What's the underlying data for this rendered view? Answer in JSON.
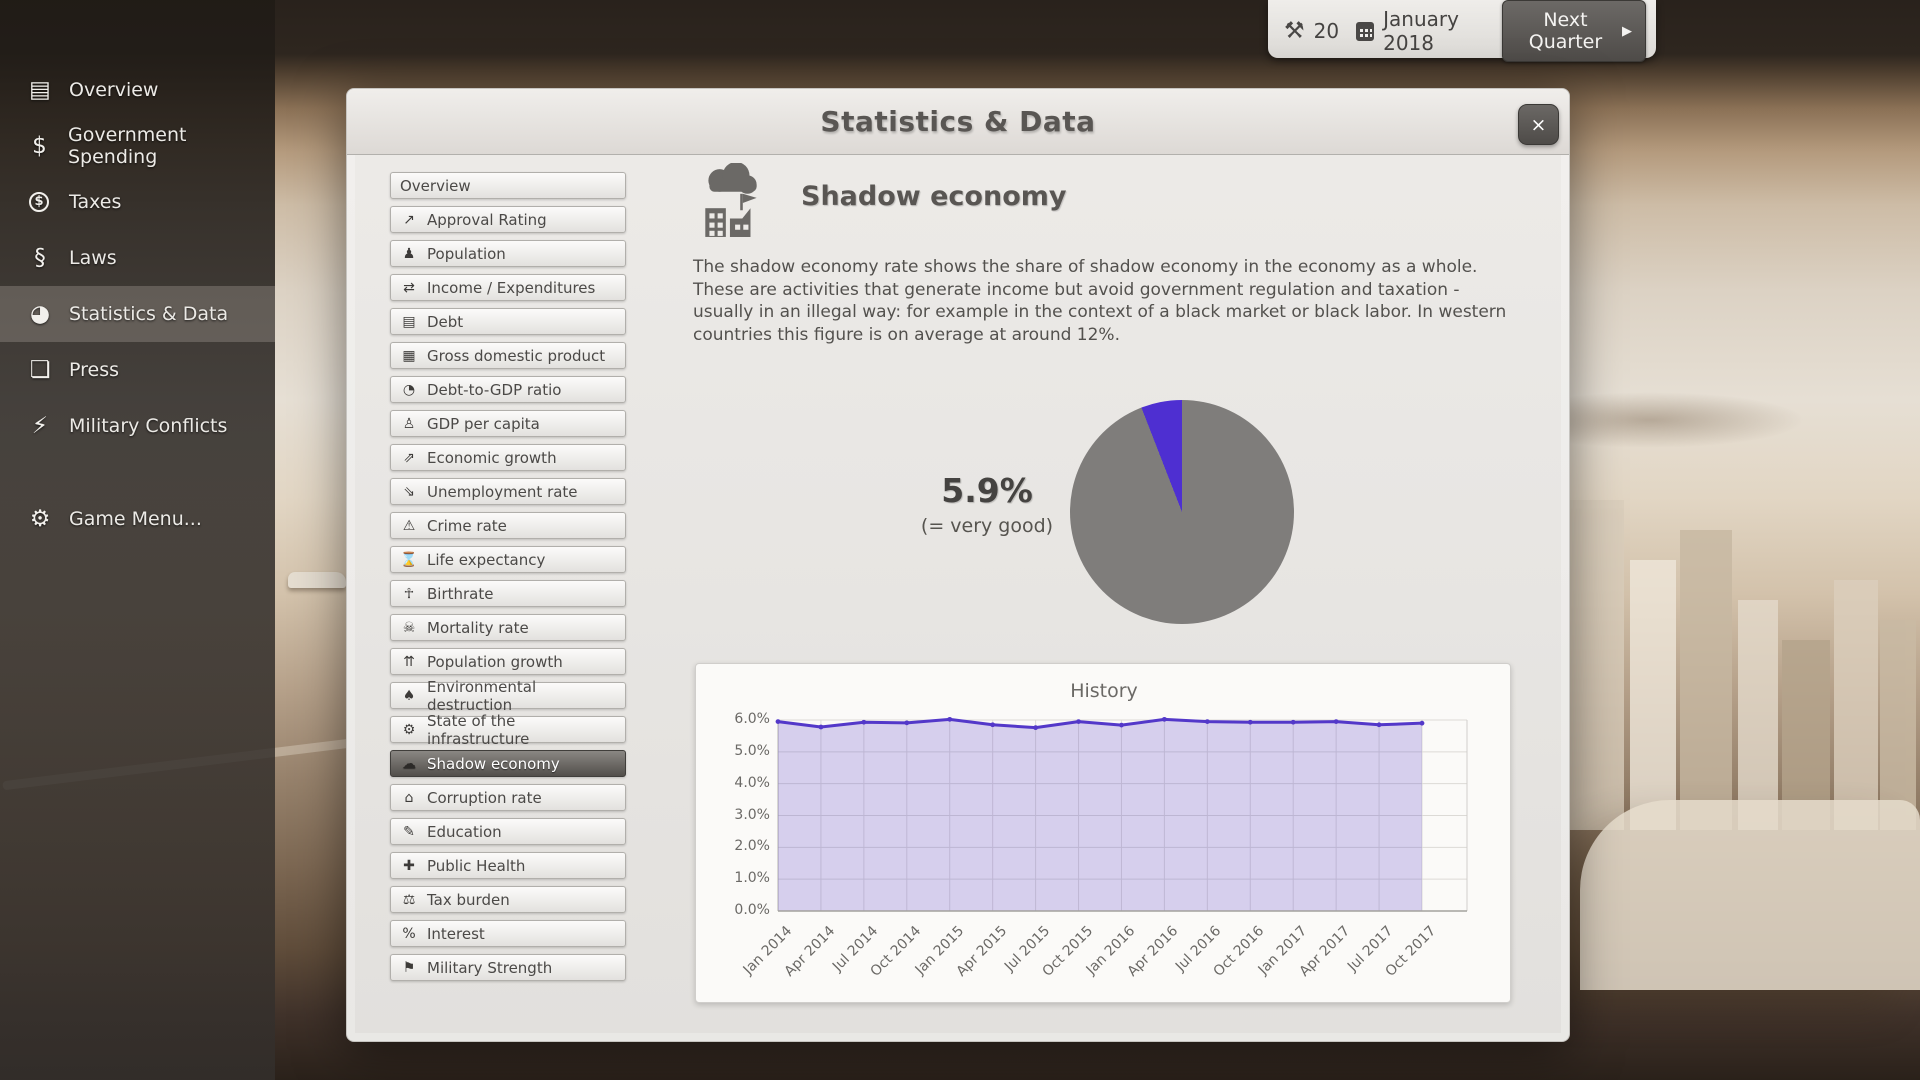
{
  "colors": {
    "accent_purple": "#4e2fd1",
    "pie_remainder_gray": "#7f7d7b",
    "chart_line": "#5338c9",
    "chart_fill": "rgba(83,56,201,0.22)"
  },
  "top_bar": {
    "tools_icon": "hammer-wrench-icon",
    "tools_glyph": "⚒",
    "tools_count": "20",
    "date": "January 2018",
    "next_quarter_label": "Next Quarter",
    "next_quarter_arrow": "▶"
  },
  "sidebar": {
    "items": [
      {
        "label": "Overview",
        "icon_name": "overview-doc-icon",
        "glyph": "▤"
      },
      {
        "label": "Government Spending",
        "icon_name": "dollar-icon",
        "glyph": "$"
      },
      {
        "label": "Taxes",
        "icon_name": "coin-icon",
        "glyph": "$",
        "coin": true
      },
      {
        "label": "Laws",
        "icon_name": "law-book-icon",
        "glyph": "§"
      },
      {
        "label": "Statistics & Data",
        "icon_name": "pie-chart-icon",
        "glyph": "◕",
        "selected": true
      },
      {
        "label": "Press",
        "icon_name": "map-icon",
        "glyph": "❏"
      },
      {
        "label": "Military Conflicts",
        "icon_name": "lightning-icon",
        "glyph": "⚡"
      },
      {
        "label": "Game Menu...",
        "icon_name": "gear-icon",
        "glyph": "⚙",
        "gap_before": true
      }
    ]
  },
  "modal": {
    "title": "Statistics & Data",
    "close_label": "×",
    "stat_list": [
      {
        "label": "Overview",
        "icon_name": "",
        "glyph": ""
      },
      {
        "label": "Approval Rating",
        "icon_name": "trend-up-icon",
        "glyph": "↗"
      },
      {
        "label": "Population",
        "icon_name": "people-icon",
        "glyph": "♟"
      },
      {
        "label": "Income / Expenditures",
        "icon_name": "exchange-arrows-icon",
        "glyph": "⇄"
      },
      {
        "label": "Debt",
        "icon_name": "safe-icon",
        "glyph": "▤"
      },
      {
        "label": "Gross domestic product",
        "icon_name": "grid-icon",
        "glyph": "▦"
      },
      {
        "label": "Debt-to-GDP ratio",
        "icon_name": "pie-ratio-icon",
        "glyph": "◔"
      },
      {
        "label": "GDP per capita",
        "icon_name": "person-icon",
        "glyph": "♙"
      },
      {
        "label": "Economic growth",
        "icon_name": "growth-chart-icon",
        "glyph": "⇗"
      },
      {
        "label": "Unemployment rate",
        "icon_name": "walking-person-icon",
        "glyph": "⇘"
      },
      {
        "label": "Crime rate",
        "icon_name": "shield-alert-icon",
        "glyph": "⚠"
      },
      {
        "label": "Life expectancy",
        "icon_name": "hospital-bed-icon",
        "glyph": "⌛"
      },
      {
        "label": "Birthrate",
        "icon_name": "baby-icon",
        "glyph": "☥"
      },
      {
        "label": "Mortality rate",
        "icon_name": "mortality-icon",
        "glyph": "☠"
      },
      {
        "label": "Population growth",
        "icon_name": "crowd-icon",
        "glyph": "⇈"
      },
      {
        "label": "Environmental destruction",
        "icon_name": "tree-icon",
        "glyph": "♠"
      },
      {
        "label": "State of the infrastructure",
        "icon_name": "train-icon",
        "glyph": "⚙"
      },
      {
        "label": "Shadow economy",
        "icon_name": "cloud-factory-icon",
        "glyph": "☁",
        "selected": true
      },
      {
        "label": "Corruption rate",
        "icon_name": "corruption-building-icon",
        "glyph": "⌂"
      },
      {
        "label": "Education",
        "icon_name": "education-book-icon",
        "glyph": "✎"
      },
      {
        "label": "Public Health",
        "icon_name": "pill-icon",
        "glyph": "✚"
      },
      {
        "label": "Tax burden",
        "icon_name": "ball-chain-icon",
        "glyph": "⚖"
      },
      {
        "label": "Interest",
        "icon_name": "interest-percent-icon",
        "glyph": "%"
      },
      {
        "label": "Military Strength",
        "icon_name": "military-flag-icon",
        "glyph": "⚑"
      }
    ],
    "detail": {
      "title": "Shadow economy",
      "description": "The shadow economy rate shows the share of shadow economy in the economy as a whole. These are activities that generate income but avoid government regulation and taxation - usually in an illegal way: for example in the context of a black market or black labor. In western countries this figure is on average at around 12%.",
      "value": "5.9%",
      "rating": "(= very good)",
      "pie_percent": 5.9
    }
  },
  "chart_data": {
    "type": "area",
    "title": "History",
    "x": [
      "Jan 2014",
      "Apr 2014",
      "Jul 2014",
      "Oct 2014",
      "Jan 2015",
      "Apr 2015",
      "Jul 2015",
      "Oct 2015",
      "Jan 2016",
      "Apr 2016",
      "Jul 2016",
      "Oct 2016",
      "Jan 2017",
      "Apr 2017",
      "Jul 2017",
      "Oct 2017"
    ],
    "values": [
      5.95,
      5.78,
      5.93,
      5.91,
      6.02,
      5.85,
      5.76,
      5.95,
      5.84,
      6.02,
      5.95,
      5.93,
      5.93,
      5.95,
      5.85,
      5.9
    ],
    "ylim": [
      0,
      6
    ],
    "yticks": [
      "0.0%",
      "1.0%",
      "2.0%",
      "3.0%",
      "4.0%",
      "5.0%",
      "6.0%"
    ],
    "xlabel": "",
    "ylabel": "",
    "grid": true,
    "legend": "none"
  }
}
